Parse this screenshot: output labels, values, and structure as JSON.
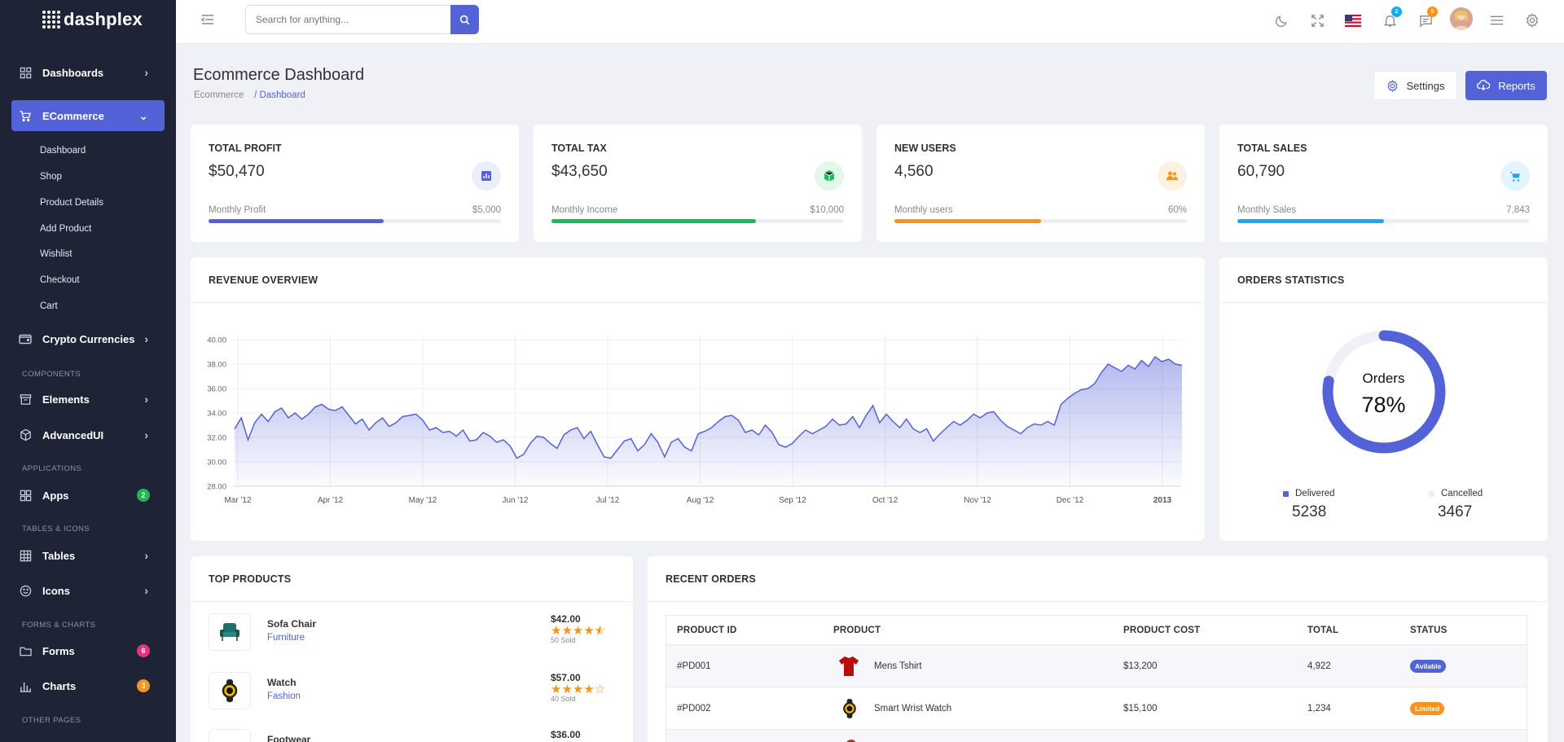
{
  "brand": {
    "name": "dashplex"
  },
  "sidebar": {
    "items": [
      {
        "label": "Dashboards",
        "icon": "grid-icon"
      },
      {
        "label": "ECommerce",
        "icon": "cart-icon"
      },
      {
        "label": "Crypto Currencies",
        "icon": "wallet-icon"
      },
      {
        "label": "Elements",
        "icon": "archive-icon"
      },
      {
        "label": "AdvancedUI",
        "icon": "box-icon"
      },
      {
        "label": "Apps",
        "icon": "apps-icon",
        "badge": "2"
      },
      {
        "label": "Tables",
        "icon": "table-icon"
      },
      {
        "label": "Icons",
        "icon": "smile-icon"
      },
      {
        "label": "Forms",
        "icon": "forms-icon",
        "badge": "6"
      },
      {
        "label": "Charts",
        "icon": "bar-chart-icon",
        "badge": "3"
      }
    ],
    "submenu": [
      "Dashboard",
      "Shop",
      "Product Details",
      "Add Product",
      "Wishlist",
      "Checkout",
      "Cart"
    ],
    "sections": [
      "COMPONENTS",
      "APPLICATIONS",
      "TABLES & ICONS",
      "FORMS & CHARTS",
      "OTHER PAGES"
    ]
  },
  "header": {
    "search_placeholder": "Search for anything...",
    "notif_count": "2",
    "msg_count": "5"
  },
  "page": {
    "title": "Ecommerce Dashboard",
    "breadcrumb": [
      "Ecommerce",
      "/ Dashboard"
    ],
    "settings_label": "Settings",
    "reports_label": "Reports"
  },
  "stats": [
    {
      "title": "TOTAL PROFIT",
      "value": "$50,470",
      "foot_label": "Monthly Profit",
      "foot_value": "$5,000",
      "progress": 0.6,
      "color": "#5462d8",
      "icon_bg": "#eceefa"
    },
    {
      "title": "TOTAL TAX",
      "value": "$43,650",
      "foot_label": "Monthly Income",
      "foot_value": "$10,000",
      "progress": 0.7,
      "color": "#1eb85a",
      "icon_bg": "#e4f7eb"
    },
    {
      "title": "NEW USERS",
      "value": "4,560",
      "foot_label": "Monthly users",
      "foot_value": "60%",
      "progress": 0.5,
      "color": "#f7931e",
      "icon_bg": "#fdf1e2"
    },
    {
      "title": "TOTAL SALES",
      "value": "60,790",
      "foot_label": "Monthly Sales",
      "foot_value": "7,843",
      "progress": 0.5,
      "color": "#1aa9f0",
      "icon_bg": "#e2f4fd"
    }
  ],
  "revenue": {
    "title": "REVENUE OVERVIEW",
    "chart_data": {
      "type": "area",
      "y_ticks": [
        "40.00",
        "38.00",
        "36.00",
        "34.00",
        "32.00",
        "30.00",
        "28.00"
      ],
      "ylim": [
        28,
        40
      ],
      "x_ticks": [
        "Mar '12",
        "Apr '12",
        "May '12",
        "Jun '12",
        "Jul '12",
        "Aug '12",
        "Sep '12",
        "Oct '12",
        "Nov '12",
        "Dec '12",
        "2013"
      ],
      "values": [
        32.7,
        33.6,
        31.8,
        33.2,
        33.9,
        33.3,
        34.1,
        34.4,
        33.6,
        34.0,
        33.5,
        33.9,
        34.5,
        34.7,
        34.3,
        34.2,
        34.5,
        33.8,
        33.1,
        33.5,
        32.6,
        33.2,
        33.6,
        32.9,
        33.2,
        33.7,
        33.8,
        33.9,
        33.4,
        32.6,
        32.8,
        32.4,
        32.5,
        32.1,
        32.6,
        31.7,
        31.8,
        32.4,
        32.1,
        31.6,
        31.8,
        31.3,
        30.3,
        30.6,
        31.5,
        32.1,
        32.0,
        31.5,
        31.1,
        32.2,
        32.6,
        32.8,
        31.9,
        32.5,
        31.4,
        30.4,
        30.3,
        31.0,
        31.7,
        31.9,
        30.9,
        31.4,
        32.3,
        31.6,
        30.4,
        31.6,
        31.9,
        31.2,
        30.9,
        32.3,
        32.5,
        32.8,
        33.3,
        33.7,
        33.8,
        33.4,
        32.4,
        32.6,
        32.2,
        33.0,
        32.4,
        31.4,
        31.2,
        31.5,
        32.1,
        32.6,
        32.3,
        32.6,
        32.9,
        33.5,
        33.0,
        33.1,
        33.7,
        32.8,
        33.8,
        34.6,
        33.2,
        33.9,
        33.3,
        32.8,
        33.5,
        32.7,
        32.4,
        32.7,
        31.7,
        32.3,
        32.8,
        33.3,
        33.0,
        33.4,
        33.9,
        33.6,
        34.0,
        34.1,
        33.4,
        32.9,
        32.6,
        32.3,
        32.8,
        33.1,
        33.0,
        33.3,
        33.0,
        34.7,
        35.2,
        35.6,
        35.9,
        36.0,
        36.4,
        37.3,
        38.0,
        37.7,
        37.4,
        37.9,
        37.6,
        38.3,
        37.8,
        38.6,
        38.2,
        38.4,
        38.0,
        37.9
      ]
    }
  },
  "orders_stats": {
    "title": "ORDERS STATISTICS",
    "center_label": "Orders",
    "center_value": "78%",
    "percent": 78,
    "delivered_label": "Delivered",
    "delivered_value": "5238",
    "cancelled_label": "Cancelled",
    "cancelled_value": "3467"
  },
  "top_products": {
    "title": "TOP PRODUCTS",
    "items": [
      {
        "name": "Sofa Chair",
        "category": "Furniture",
        "price": "$42.00",
        "sold": "50 Sold",
        "rating": 4.5
      },
      {
        "name": "Watch",
        "category": "Fashion",
        "price": "$57.00",
        "sold": "40 Sold",
        "rating": 4
      },
      {
        "name": "Footwear",
        "category": "",
        "price": "$36.00",
        "sold": "",
        "rating": 0
      }
    ]
  },
  "recent_orders": {
    "title": "RECENT ORDERS",
    "columns": [
      "PRODUCT ID",
      "PRODUCT",
      "PRODUCT COST",
      "TOTAL",
      "STATUS"
    ],
    "rows": [
      {
        "id": "#PD001",
        "product": "Mens Tshirt",
        "cost": "$13,200",
        "total": "4,922",
        "status": "Avilable",
        "status_color": "#5462d8"
      },
      {
        "id": "#PD002",
        "product": "Smart Wrist Watch",
        "cost": "$15,100",
        "total": "1,234",
        "status": "Limited",
        "status_color": "#f7931e"
      }
    ]
  }
}
